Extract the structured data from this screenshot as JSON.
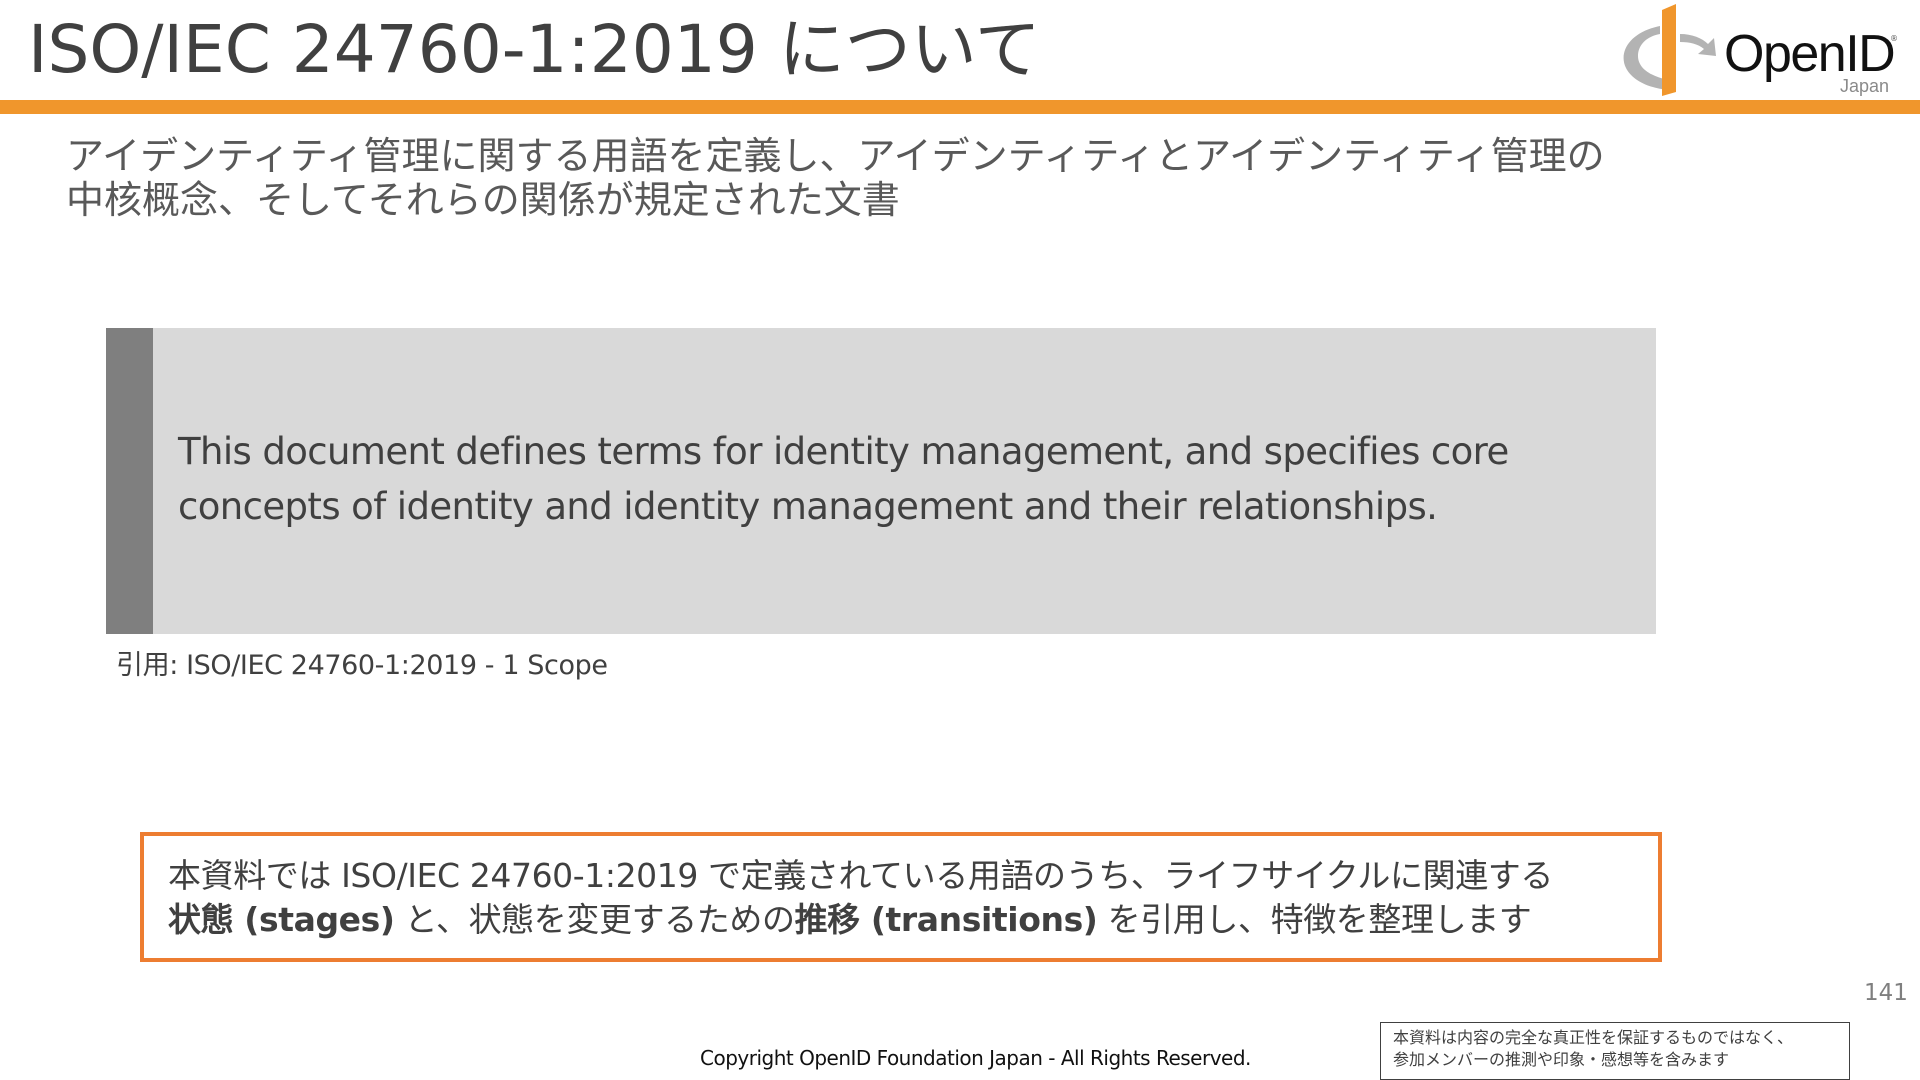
{
  "header": {
    "title": "ISO/IEC 24760-1:2019 について",
    "logo_text": "OpenID",
    "logo_subtext": "Japan",
    "logo_mark": "®",
    "rule_color": "#f0962c"
  },
  "subtitle": {
    "line1": "アイデンティティ管理に関する用語を定義し、アイデンティティとアイデンティティ管理の",
    "line2": "中核概念、そしてそれらの関係が規定された文書"
  },
  "quote": {
    "line1": "This document defines terms for identity management, and specifies core",
    "line2": "concepts of identity and identity management and their relationships."
  },
  "citation": "引用: ISO/IEC 24760-1:2019 - 1 Scope",
  "note": {
    "part1": "本資料では ISO/IEC 24760-1:2019 で定義されている用語のうち、ライフサイクルに関連する",
    "bold1": "状態 (stages)",
    "part2": " と、状態を変更するための",
    "bold2": "推移 (transitions)",
    "part3": " を引用し、特徴を整理します",
    "border_color": "#ed7d31"
  },
  "footer": {
    "page_number": "141",
    "copyright": "Copyright OpenID Foundation Japan - All Rights Reserved.",
    "disclaimer_line1": "本資料は内容の完全な真正性を保証するものではなく、",
    "disclaimer_line2": "参加メンバーの推測や印象・感想等を含みます"
  }
}
